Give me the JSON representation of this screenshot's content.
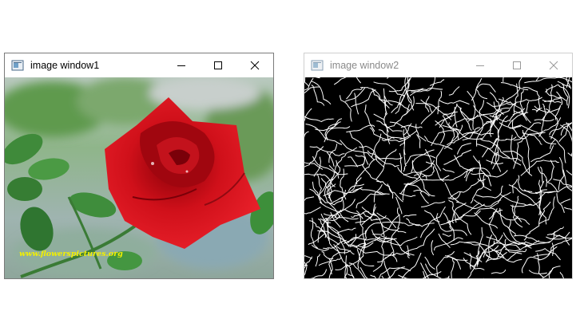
{
  "windows": [
    {
      "title": "image window1",
      "active": true,
      "content": {
        "kind": "photo",
        "subject": "red rose on stem with green leaves, blurred background",
        "watermark": "www.flowerspictures.org"
      }
    },
    {
      "title": "image window2",
      "active": false,
      "content": {
        "kind": "edge-detection",
        "colors": {
          "background": "#000000",
          "edges": "#ffffff"
        }
      }
    }
  ],
  "icons": {
    "app": "app-window-icon",
    "minimize": "minimize-icon",
    "maximize": "maximize-icon",
    "close": "close-icon"
  }
}
